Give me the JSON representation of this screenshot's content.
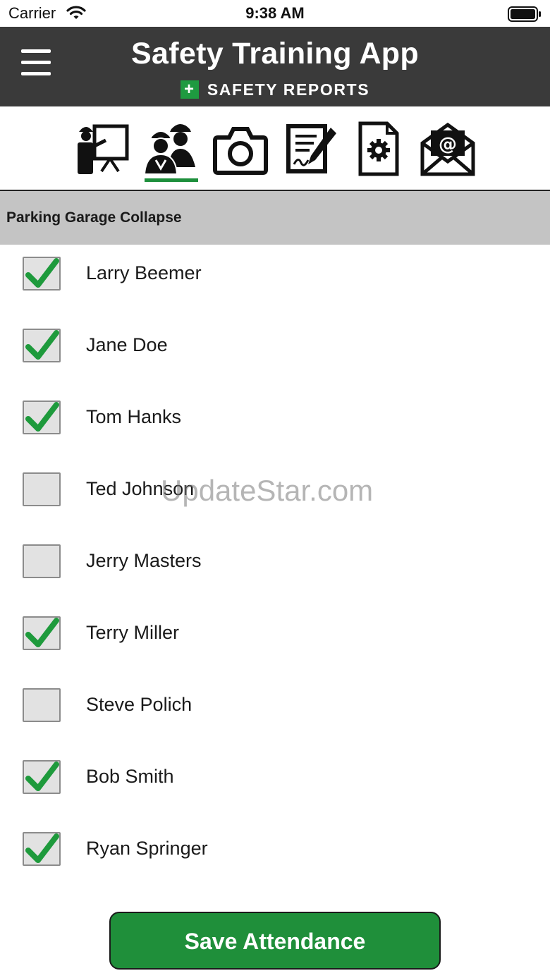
{
  "status_bar": {
    "carrier": "Carrier",
    "time": "9:38 AM"
  },
  "header": {
    "title": "Safety Training App",
    "brand_text": "SAFETY REPORTS",
    "brand_mark": "+"
  },
  "toolbar": {
    "items": [
      {
        "icon": "presenter-icon",
        "selected": false
      },
      {
        "icon": "workers-icon",
        "selected": true
      },
      {
        "icon": "camera-icon",
        "selected": false
      },
      {
        "icon": "signature-icon",
        "selected": false
      },
      {
        "icon": "document-settings-icon",
        "selected": false
      },
      {
        "icon": "email-icon",
        "selected": false
      }
    ]
  },
  "section": {
    "title": "Parking Garage Collapse"
  },
  "attendees": [
    {
      "name": "Larry Beemer",
      "checked": true
    },
    {
      "name": "Jane Doe",
      "checked": true
    },
    {
      "name": "Tom Hanks",
      "checked": true
    },
    {
      "name": "Ted Johnson",
      "checked": false
    },
    {
      "name": "Jerry Masters",
      "checked": false
    },
    {
      "name": "Terry Miller",
      "checked": true
    },
    {
      "name": "Steve Polich",
      "checked": false
    },
    {
      "name": "Bob Smith",
      "checked": true
    },
    {
      "name": "Ryan Springer",
      "checked": true
    }
  ],
  "watermark": "UpdateStar.com",
  "save_button": {
    "label": "Save Attendance"
  },
  "colors": {
    "header_bg": "#3a3a3a",
    "accent_green": "#1f8f3a",
    "section_bg": "#c4c4c4"
  }
}
